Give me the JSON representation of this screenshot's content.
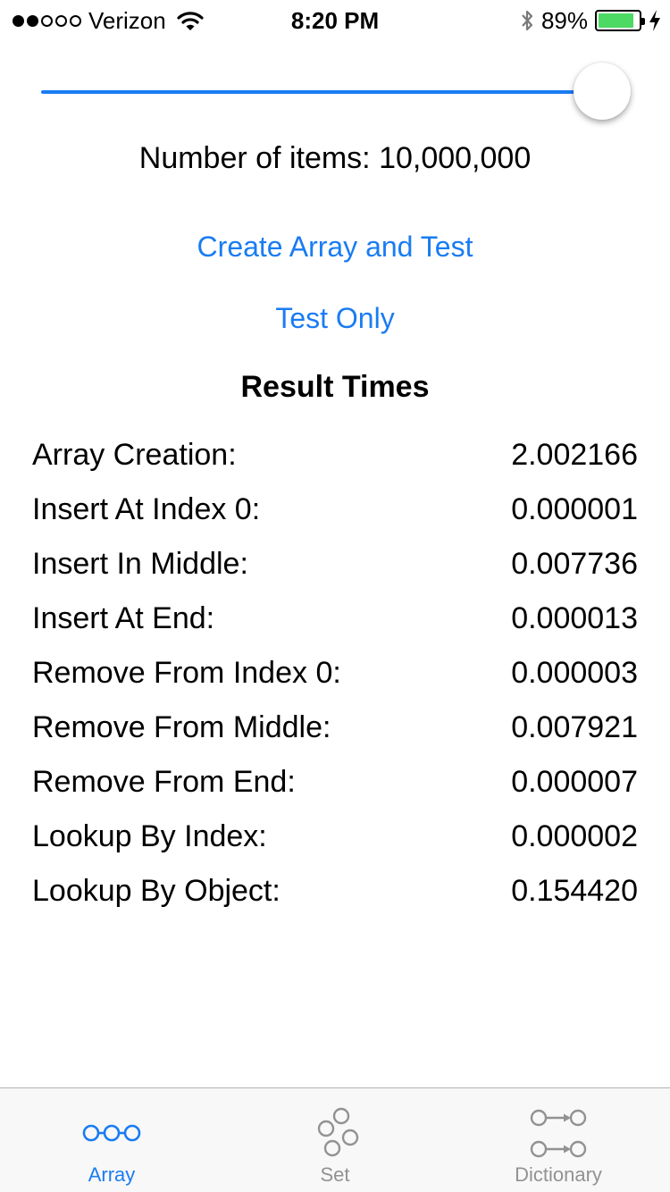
{
  "status_bar": {
    "carrier": "Verizon",
    "time": "8:20 PM",
    "battery_percent": "89%",
    "battery_level": 0.89,
    "signal_strength": 2,
    "signal_max": 5,
    "icons": [
      "wifi-icon",
      "bluetooth-icon",
      "battery-icon",
      "charging-bolt-icon"
    ]
  },
  "slider": {
    "value": 1.0
  },
  "item_count": "Number of items: 10,000,000",
  "buttons": {
    "create": "Create Array and Test",
    "test_only": "Test Only"
  },
  "results": {
    "title": "Result Times",
    "rows": [
      {
        "label": "Array Creation:",
        "value": "2.002166"
      },
      {
        "label": "Insert At Index 0:",
        "value": "0.000001"
      },
      {
        "label": "Insert In Middle:",
        "value": "0.007736"
      },
      {
        "label": "Insert At End:",
        "value": "0.000013"
      },
      {
        "label": "Remove From Index 0:",
        "value": "0.000003"
      },
      {
        "label": "Remove From Middle:",
        "value": "0.007921"
      },
      {
        "label": "Remove From End:",
        "value": "0.000007"
      },
      {
        "label": "Lookup By Index:",
        "value": "0.000002"
      },
      {
        "label": "Lookup By Object:",
        "value": "0.154420"
      }
    ]
  },
  "tabs": [
    {
      "label": "Array",
      "icon": "array-icon",
      "active": true
    },
    {
      "label": "Set",
      "icon": "set-icon",
      "active": false
    },
    {
      "label": "Dictionary",
      "icon": "dictionary-icon",
      "active": false
    }
  ],
  "colors": {
    "accent": "#1a7cf2",
    "battery": "#4cd964",
    "tab_inactive": "#929292"
  }
}
